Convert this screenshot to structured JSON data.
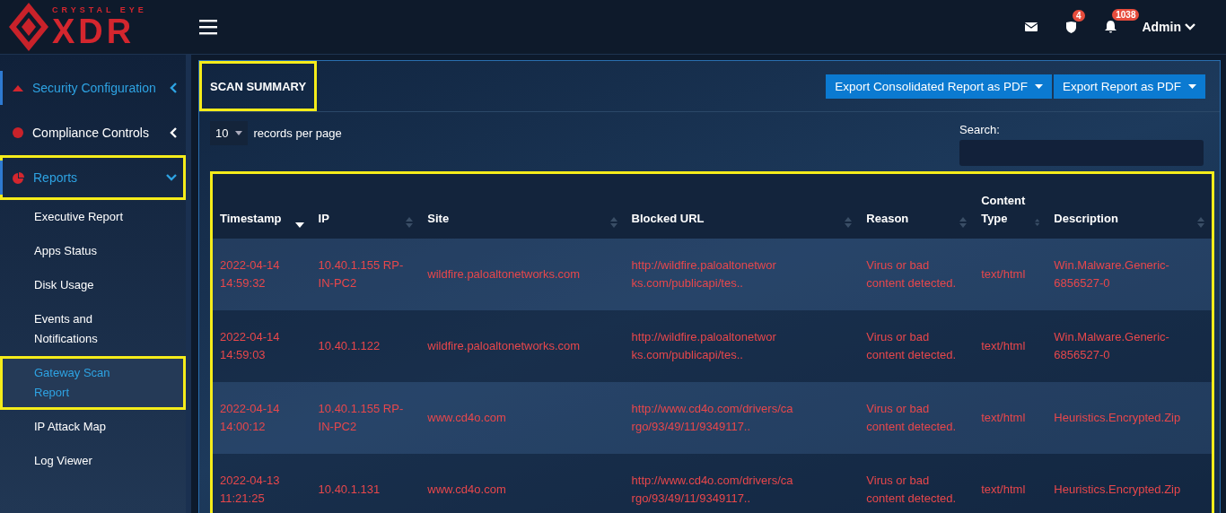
{
  "logo": {
    "tagline": "CRYSTAL EYE",
    "name": "XDR"
  },
  "header": {
    "badges": [
      {
        "kind": "mail"
      },
      {
        "kind": "shield",
        "count": "4"
      },
      {
        "kind": "bell",
        "count": "1038"
      }
    ],
    "user": "Admin"
  },
  "sidebar": {
    "items": [
      {
        "label": "Security Configuration",
        "kind": "triangle",
        "selected": true,
        "expanded": false,
        "highlighted": false
      },
      {
        "label": "Compliance Controls",
        "kind": "dot",
        "selected": false,
        "expanded": false,
        "highlighted": false
      },
      {
        "label": "Reports",
        "kind": "pie",
        "selected": true,
        "expanded": true,
        "highlighted": true,
        "children": [
          {
            "label": "Executive Report",
            "selected": false,
            "highlighted": false
          },
          {
            "label": "Apps Status",
            "selected": false,
            "highlighted": false
          },
          {
            "label": "Disk Usage",
            "selected": false,
            "highlighted": false
          },
          {
            "label": "Events and Notifications",
            "selected": false,
            "highlighted": false
          },
          {
            "label": "Gateway Scan Report",
            "selected": true,
            "highlighted": true
          },
          {
            "label": "IP Attack Map",
            "selected": false,
            "highlighted": false
          },
          {
            "label": "Log Viewer",
            "selected": false,
            "highlighted": false
          }
        ]
      }
    ]
  },
  "panel": {
    "title": "SCAN SUMMARY",
    "title_highlighted": true,
    "buttons": [
      "Export Consolidated Report as PDF",
      "Export Report as PDF"
    ],
    "page_size": "10",
    "page_size_label": "records per page",
    "search_label": "Search:",
    "table": {
      "highlighted": true,
      "columns": [
        {
          "label": "Timestamp",
          "sorted": true
        },
        {
          "label": "IP",
          "sorted": false
        },
        {
          "label": "Site",
          "sorted": false
        },
        {
          "label": "Blocked URL",
          "sorted": false
        },
        {
          "label": "Reason",
          "sorted": false
        },
        {
          "label": "Content Type",
          "sorted": false
        },
        {
          "label": "Description",
          "sorted": false
        }
      ],
      "rows": [
        [
          "2022-04-14 14:59:32",
          "10.40.1.155 RP-IN-PC2",
          "wildfire.paloaltonetworks.com",
          "http://wildfire.paloaltonetwor ks.com/publicapi/tes..",
          "Virus or bad content detected.",
          "text/html",
          "Win.Malware.Generic-6856527-0"
        ],
        [
          "2022-04-14 14:59:03",
          "10.40.1.122",
          "wildfire.paloaltonetworks.com",
          "http://wildfire.paloaltonetwor ks.com/publicapi/tes..",
          "Virus or bad content detected.",
          "text/html",
          "Win.Malware.Generic-6856527-0"
        ],
        [
          "2022-04-14 14:00:12",
          "10.40.1.155 RP-IN-PC2",
          "www.cd4o.com",
          "http://www.cd4o.com/drivers/ca rgo/93/49/11/9349117..",
          "Virus or bad content detected.",
          "text/html",
          "Heuristics.Encrypted.Zip"
        ],
        [
          "2022-04-13 11:21:25",
          "10.40.1.131",
          "www.cd4o.com",
          "http://www.cd4o.com/drivers/ca rgo/93/49/11/9349117..",
          "Virus or bad content detected.",
          "text/html",
          "Heuristics.Encrypted.Zip"
        ]
      ]
    }
  }
}
